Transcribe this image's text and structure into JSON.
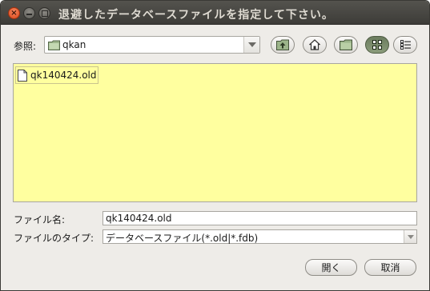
{
  "window": {
    "title": "退避したデータベースファイルを指定して下さい。"
  },
  "toolbar": {
    "look_in_label": "参照:",
    "look_in_value": "qkan"
  },
  "file_list": {
    "items": [
      {
        "name": "qk140424.old"
      }
    ],
    "background_color": "#ffff9f"
  },
  "form": {
    "filename_label": "ファイル名:",
    "filename_value": "qk140424.old",
    "filetype_label": "ファイルのタイプ:",
    "filetype_value": "データベースファイル(*.old|*.fdb)"
  },
  "buttons": {
    "open_label": "開く",
    "cancel_label": "取消"
  },
  "colors": {
    "titlebar": "#3d3c38",
    "close_button": "#e05a2b"
  }
}
